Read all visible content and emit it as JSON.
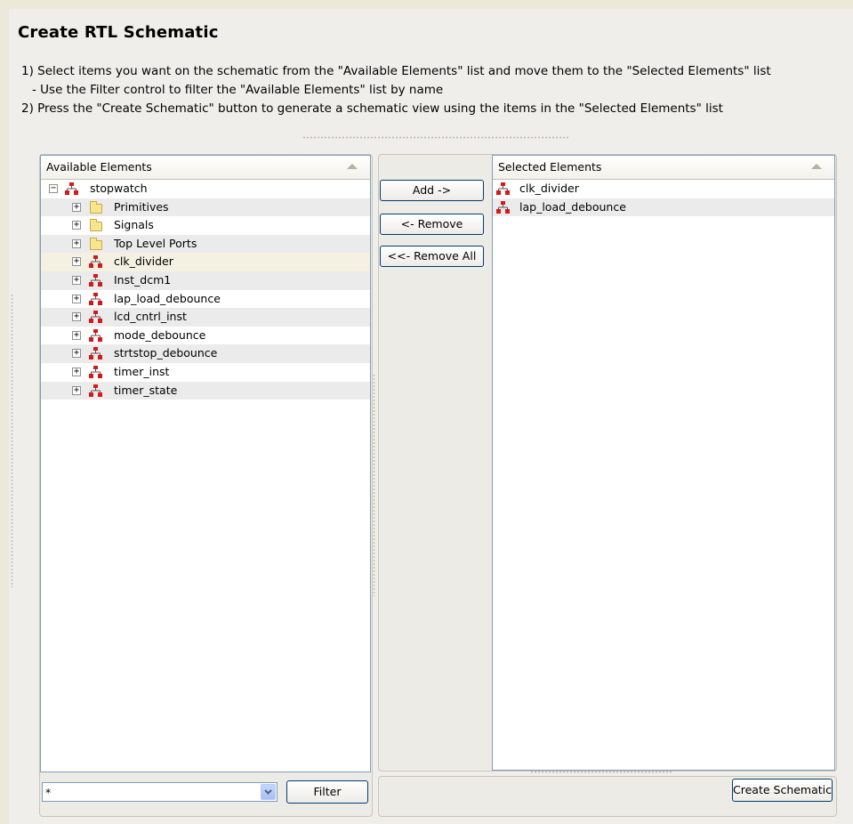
{
  "title": "Create RTL Schematic",
  "instructions": {
    "line1": "1) Select items you want on the schematic from the \"Available Elements\" list and move them to the \"Selected Elements\" list",
    "line2": "- Use the Filter control to filter the \"Available Elements\" list by name",
    "line3": "2) Press the \"Create Schematic\" button to generate a schematic view using the items in the \"Selected Elements\" list"
  },
  "available": {
    "header": "Available Elements",
    "root": {
      "label": "stopwatch",
      "icon": "hierarchy-icon",
      "expanded": true
    },
    "items": [
      {
        "label": "Primitives",
        "icon": "folder-icon"
      },
      {
        "label": "Signals",
        "icon": "folder-icon"
      },
      {
        "label": "Top Level Ports",
        "icon": "folder-icon"
      },
      {
        "label": "clk_divider",
        "icon": "hierarchy-icon"
      },
      {
        "label": "Inst_dcm1",
        "icon": "hierarchy-icon"
      },
      {
        "label": "lap_load_debounce",
        "icon": "hierarchy-icon"
      },
      {
        "label": "lcd_cntrl_inst",
        "icon": "hierarchy-icon"
      },
      {
        "label": "mode_debounce",
        "icon": "hierarchy-icon"
      },
      {
        "label": "strtstop_debounce",
        "icon": "hierarchy-icon"
      },
      {
        "label": "timer_inst",
        "icon": "hierarchy-icon"
      },
      {
        "label": "timer_state",
        "icon": "hierarchy-icon"
      }
    ]
  },
  "buttons": {
    "add": "Add ->",
    "remove": "<- Remove",
    "remove_all": "<<- Remove All",
    "filter": "Filter",
    "create": "Create Schematic"
  },
  "filter": {
    "value": "*"
  },
  "selected": {
    "header": "Selected Elements",
    "items": [
      {
        "label": "clk_divider",
        "icon": "hierarchy-icon"
      },
      {
        "label": "lap_load_debounce",
        "icon": "hierarchy-icon"
      }
    ]
  },
  "colors": {
    "hierarchy_icon": "#d81818",
    "folder": "#f8e58c",
    "list_border": "#7f9db9"
  }
}
